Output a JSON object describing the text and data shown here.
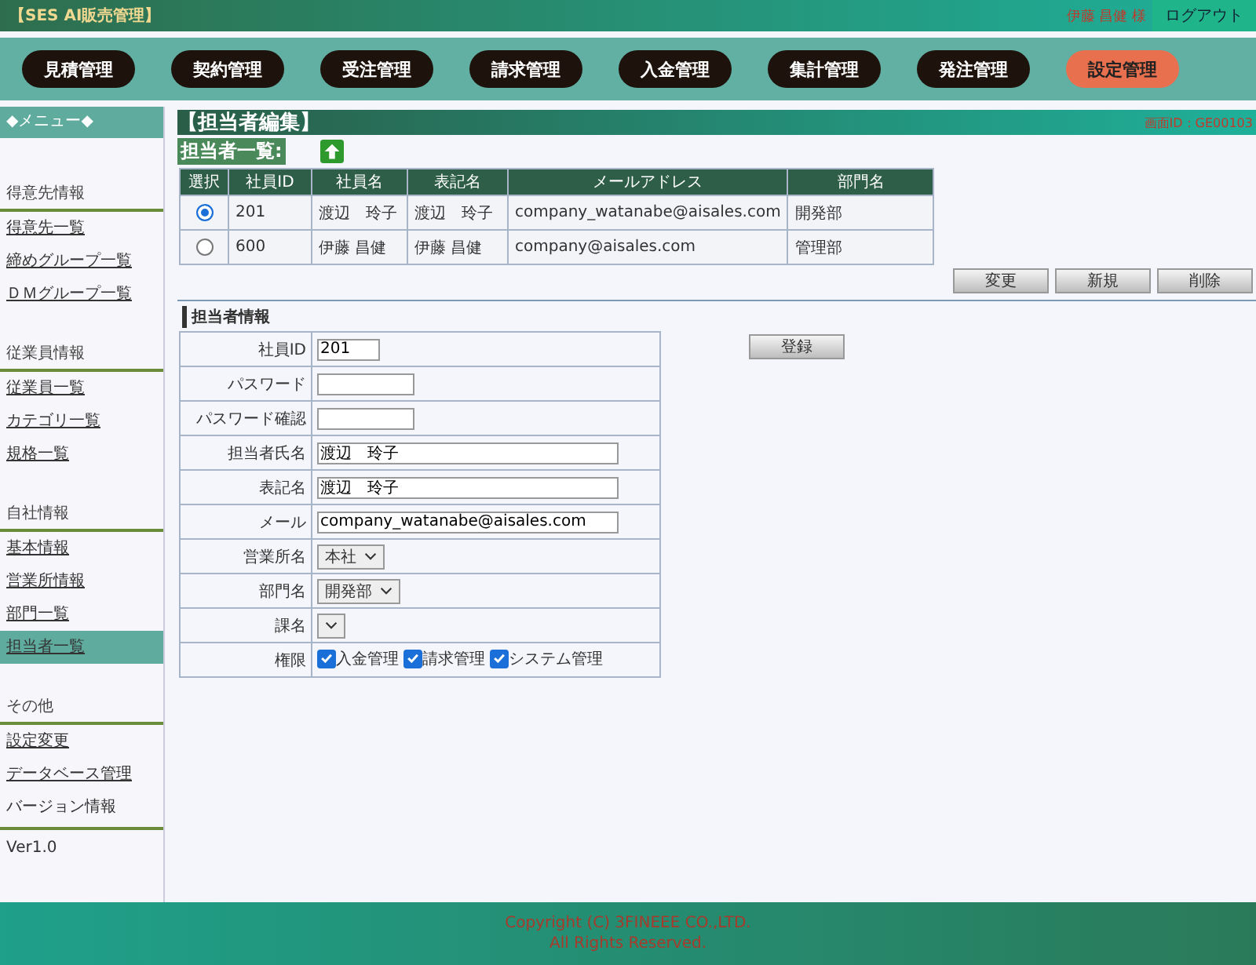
{
  "header": {
    "app_title": "【SES AI販売管理】",
    "user": "伊藤 昌健 様",
    "logout": "ログアウト"
  },
  "nav": [
    {
      "label": "見積管理",
      "selected": false
    },
    {
      "label": "契約管理",
      "selected": false
    },
    {
      "label": "受注管理",
      "selected": false
    },
    {
      "label": "請求管理",
      "selected": false
    },
    {
      "label": "入金管理",
      "selected": false
    },
    {
      "label": "集計管理",
      "selected": false
    },
    {
      "label": "発注管理",
      "selected": false
    },
    {
      "label": "設定管理",
      "selected": true
    }
  ],
  "sidebar": {
    "title": "◆メニュー◆",
    "sections": [
      {
        "heading": "得意先情報",
        "items": [
          {
            "label": "得意先一覧",
            "link": true,
            "selected": false
          },
          {
            "label": "締めグループ一覧",
            "link": true,
            "selected": false
          },
          {
            "label": "ＤＭグループ一覧",
            "link": true,
            "selected": false
          }
        ]
      },
      {
        "heading": "従業員情報",
        "items": [
          {
            "label": "従業員一覧",
            "link": true,
            "selected": false
          },
          {
            "label": "カテゴリ一覧",
            "link": true,
            "selected": false
          },
          {
            "label": "規格一覧",
            "link": true,
            "selected": false
          }
        ]
      },
      {
        "heading": "自社情報",
        "items": [
          {
            "label": "基本情報",
            "link": true,
            "selected": false
          },
          {
            "label": "営業所情報",
            "link": true,
            "selected": false
          },
          {
            "label": "部門一覧",
            "link": true,
            "selected": false
          },
          {
            "label": "担当者一覧",
            "link": true,
            "selected": true
          }
        ]
      },
      {
        "heading": "その他",
        "items": [
          {
            "label": "設定変更",
            "link": true,
            "selected": false
          },
          {
            "label": "データベース管理",
            "link": true,
            "selected": false
          },
          {
            "label": "バージョン情報",
            "link": false,
            "selected": false
          }
        ]
      }
    ],
    "version": "Ver1.0"
  },
  "page": {
    "title": "【担当者編集】",
    "screen_id": "画面ID：GE00103"
  },
  "list": {
    "heading": "担当者一覧:",
    "select_header": "選択",
    "columns": [
      "社員ID",
      "社員名",
      "表記名",
      "メールアドレス",
      "部門名"
    ],
    "rows": [
      {
        "selected": true,
        "cells": [
          "201",
          "渡辺　玲子",
          "渡辺　玲子",
          "company_watanabe@aisales.com",
          "開発部"
        ]
      },
      {
        "selected": false,
        "cells": [
          "600",
          "伊藤 昌健",
          "伊藤 昌健",
          "company@aisales.com",
          "管理部"
        ]
      }
    ],
    "buttons": [
      "変更",
      "新規",
      "削除"
    ]
  },
  "form": {
    "heading": "担当者情報",
    "submit": "登録",
    "fields": [
      {
        "kind": "short",
        "label": "社員ID",
        "value": "201"
      },
      {
        "kind": "password",
        "label": "パスワード"
      },
      {
        "kind": "password",
        "label": "パスワード確認"
      },
      {
        "kind": "text",
        "label": "担当者氏名",
        "value": "渡辺　玲子"
      },
      {
        "kind": "text",
        "label": "表記名",
        "value": "渡辺　玲子"
      },
      {
        "kind": "text",
        "label": "メール",
        "value": "company_watanabe@aisales.com"
      },
      {
        "kind": "select",
        "label": "営業所名",
        "value": "本社"
      },
      {
        "kind": "select",
        "label": "部門名",
        "value": "開発部"
      },
      {
        "kind": "select",
        "label": "課名"
      },
      {
        "kind": "checks",
        "label": "権限",
        "options": [
          {
            "label": "入金管理",
            "checked": true
          },
          {
            "label": "請求管理",
            "checked": true
          },
          {
            "label": "システム管理",
            "checked": true
          }
        ]
      }
    ]
  },
  "footer": {
    "lines": [
      "Copyright (C) 3FINEEE CO.,LTD.",
      "All Rights Reserved."
    ]
  }
}
